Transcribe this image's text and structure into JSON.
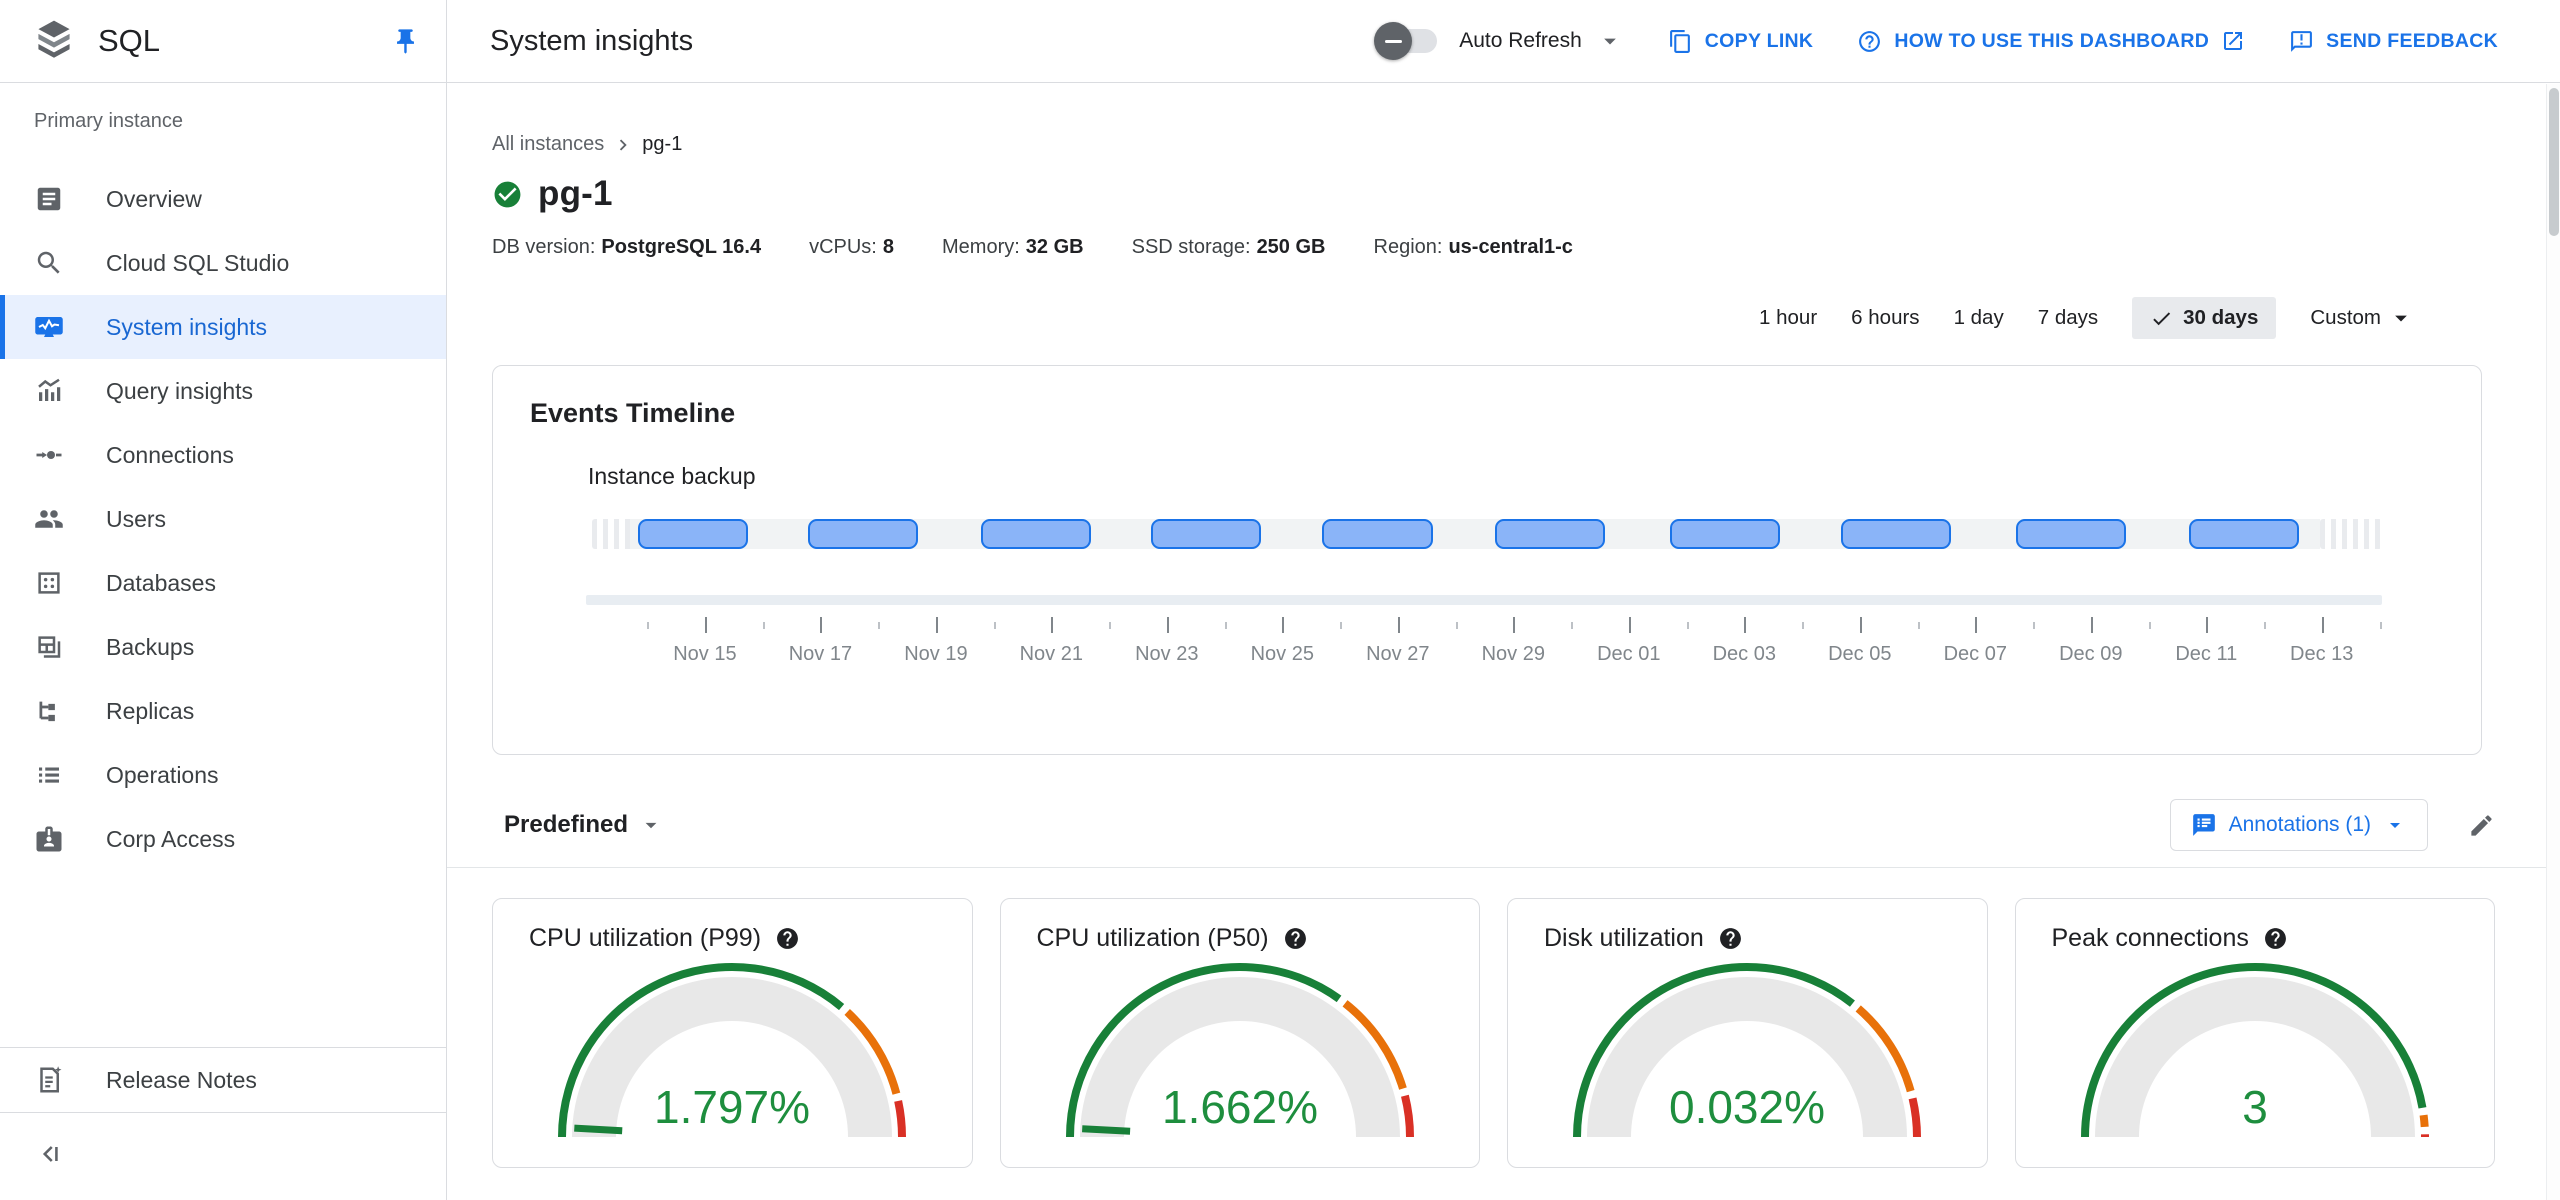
{
  "app": {
    "product": "SQL"
  },
  "header": {
    "title": "System insights",
    "auto_refresh_label": "Auto Refresh",
    "copy_link_label": "COPY LINK",
    "how_to_label": "HOW TO USE THIS DASHBOARD",
    "send_feedback_label": "SEND FEEDBACK"
  },
  "sidebar": {
    "section_label": "Primary instance",
    "items": [
      {
        "label": "Overview",
        "icon": "article",
        "active": false
      },
      {
        "label": "Cloud SQL Studio",
        "icon": "search",
        "active": false
      },
      {
        "label": "System insights",
        "icon": "monitor",
        "active": true
      },
      {
        "label": "Query insights",
        "icon": "query",
        "active": false
      },
      {
        "label": "Connections",
        "icon": "connections",
        "active": false
      },
      {
        "label": "Users",
        "icon": "users",
        "active": false
      },
      {
        "label": "Databases",
        "icon": "databases",
        "active": false
      },
      {
        "label": "Backups",
        "icon": "backups",
        "active": false
      },
      {
        "label": "Replicas",
        "icon": "replicas",
        "active": false
      },
      {
        "label": "Operations",
        "icon": "operations",
        "active": false
      },
      {
        "label": "Corp Access",
        "icon": "corp",
        "active": false
      }
    ],
    "release_notes_label": "Release Notes"
  },
  "content": {
    "breadcrumb": {
      "parent": "All instances",
      "current": "pg-1"
    },
    "instance": {
      "name": "pg-1",
      "status": "healthy",
      "details": [
        {
          "label": "DB version:",
          "value": "PostgreSQL 16.4"
        },
        {
          "label": "vCPUs:",
          "value": "8"
        },
        {
          "label": "Memory:",
          "value": "32 GB"
        },
        {
          "label": "SSD storage:",
          "value": "250 GB"
        },
        {
          "label": "Region:",
          "value": "us-central1-c"
        }
      ]
    },
    "time_range": {
      "options": [
        "1 hour",
        "6 hours",
        "1 day",
        "7 days",
        "30 days",
        "Custom"
      ],
      "selected": "30 days"
    },
    "events_timeline": {
      "title": "Events Timeline",
      "series_label": "Instance backup",
      "axis_labels": [
        "Nov 15",
        "Nov 17",
        "Nov 19",
        "Nov 21",
        "Nov 23",
        "Nov 25",
        "Nov 27",
        "Nov 29",
        "Dec 01",
        "Dec 03",
        "Dec 05",
        "Dec 07",
        "Dec 09",
        "Dec 11",
        "Dec 13"
      ],
      "tick_start_frac": 0.0308,
      "tick_step_frac": 0.03226,
      "tick_count": 31,
      "pills": [
        {
          "start": 0.0257,
          "end": 0.0872
        },
        {
          "start": 0.1207,
          "end": 0.1822
        },
        {
          "start": 0.2173,
          "end": 0.2788
        },
        {
          "start": 0.3123,
          "end": 0.3738
        },
        {
          "start": 0.4078,
          "end": 0.4698
        },
        {
          "start": 0.5045,
          "end": 0.566
        },
        {
          "start": 0.6022,
          "end": 0.6637
        },
        {
          "start": 0.6978,
          "end": 0.7593
        },
        {
          "start": 0.7955,
          "end": 0.857
        },
        {
          "start": 0.8922,
          "end": 0.9537
        }
      ]
    },
    "tools": {
      "predefined_label": "Predefined",
      "annotations_label": "Annotations (1)"
    },
    "gauges": [
      {
        "title": "CPU utilization (P99)",
        "value": "1.797%",
        "segments": {
          "green": 0.73,
          "orange": 0.195,
          "red": 0.075
        },
        "needle_frac": 0.018
      },
      {
        "title": "CPU utilization (P50)",
        "value": "1.662%",
        "segments": {
          "green": 0.705,
          "orange": 0.21,
          "red": 0.085
        },
        "needle_frac": 0.0166
      },
      {
        "title": "Disk utilization",
        "value": "0.032%",
        "segments": {
          "green": 0.72,
          "orange": 0.2,
          "red": 0.08
        },
        "needle_frac": null
      },
      {
        "title": "Peak connections",
        "value": "3",
        "segments": {
          "green": 0.952,
          "orange": 0.036,
          "red": 0.012
        },
        "needle_frac": null
      }
    ]
  },
  "colors": {
    "accent_blue": "#1a73e8",
    "nav_active_text": "#1967d2",
    "nav_active_bg": "#e8f0fe",
    "arc_green": "#188038",
    "value_green": "#1e8e3e",
    "arc_orange": "#e8710a",
    "arc_red": "#d93025",
    "gauge_band": "#e8e8e8",
    "pill_fill": "#8ab4f8",
    "pill_border": "#1a73e8",
    "border": "#dadce0"
  }
}
